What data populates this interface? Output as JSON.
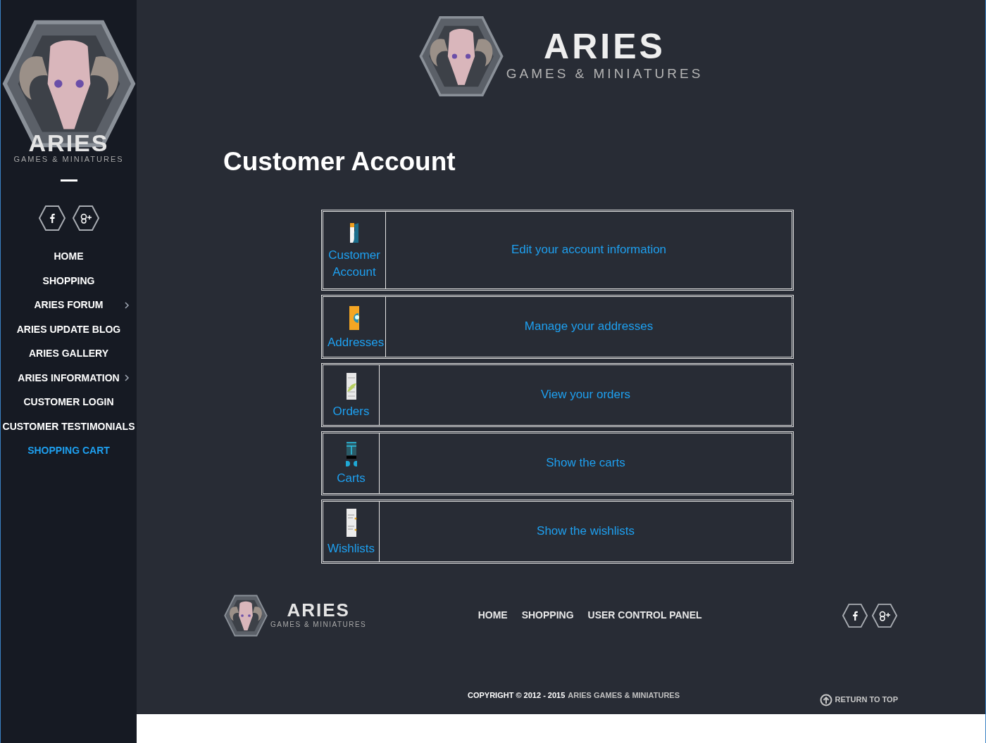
{
  "sidebar": {
    "logo": {
      "wordmark": "ARIES",
      "tagline": "GAMES & MINIATURES"
    },
    "menu": [
      {
        "label": "HOME",
        "has_submenu": false,
        "selected": false
      },
      {
        "label": "SHOPPING",
        "has_submenu": false,
        "selected": false
      },
      {
        "label": "ARIES FORUM",
        "has_submenu": true,
        "selected": false
      },
      {
        "label": "ARIES UPDATE BLOG",
        "has_submenu": false,
        "selected": false
      },
      {
        "label": "ARIES GALLERY",
        "has_submenu": false,
        "selected": false
      },
      {
        "label": "ARIES INFORMATION",
        "has_submenu": true,
        "selected": false
      },
      {
        "label": "CUSTOMER LOGIN",
        "has_submenu": false,
        "selected": false
      },
      {
        "label": "CUSTOMER TESTIMONIALS",
        "has_submenu": false,
        "selected": false
      },
      {
        "label": "SHOPPING CART",
        "has_submenu": false,
        "selected": true
      }
    ]
  },
  "header": {
    "logo": {
      "wordmark": "ARIES",
      "tagline": "GAMES & MINIATURES"
    }
  },
  "page_title": "Customer Account",
  "account_links": [
    {
      "label": "Customer Account",
      "description": "Edit your account information"
    },
    {
      "label": "Addresses",
      "description": "Manage your addresses"
    },
    {
      "label": "Orders",
      "description": "View your orders"
    },
    {
      "label": "Carts",
      "description": "Show the carts"
    },
    {
      "label": "Wishlists",
      "description": "Show the wishlists"
    }
  ],
  "footer": {
    "logo": {
      "wordmark": "ARIES",
      "tagline": "GAMES & MINIATURES"
    },
    "nav": [
      "HOME",
      "SHOPPING",
      "USER CONTROL PANEL"
    ],
    "copyright": "COPYRIGHT © 2012 - 2015",
    "copyright_owner": "ARIES GAMES & MINIATURES",
    "return_to_top": "RETURN TO TOP"
  }
}
